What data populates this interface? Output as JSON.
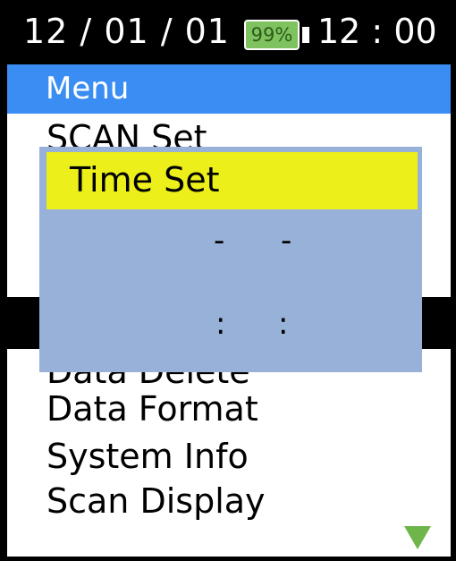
{
  "status_bar": {
    "date": "12 / 01 / 01",
    "battery": "99%",
    "time": "12 : 00"
  },
  "menu": {
    "title": "Menu",
    "items": [
      "SCAN Set",
      "Data Delete",
      "Data Format",
      "System Info",
      "Scan Display"
    ]
  },
  "dialog": {
    "title": "Time Set",
    "date_separator": "-",
    "time_separator": ":"
  },
  "icons": {
    "scroll_down": "triangle-down-icon",
    "battery": "battery-icon"
  },
  "colors": {
    "header_blue": "#3a8ef3",
    "dialog_bg": "#97b1d8",
    "dialog_title_bg": "#ecef1a",
    "battery_fill": "#7ec35f",
    "arrow_green": "#6fb64a"
  }
}
